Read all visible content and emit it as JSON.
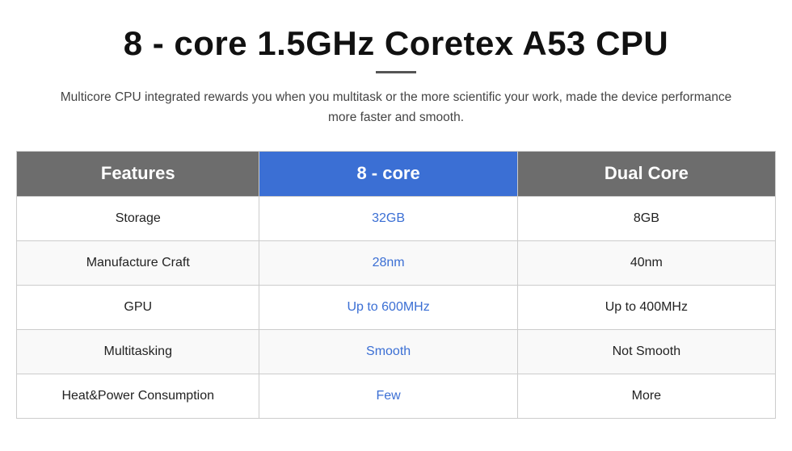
{
  "header": {
    "title": "8 - core 1.5GHz Coretex A53 CPU",
    "subtitle": "Multicore CPU integrated rewards you when you multitask or the more scientific your work, made the device performance more faster and smooth."
  },
  "table": {
    "columns": {
      "features": "Features",
      "col1": "8 - core",
      "col2": "Dual Core"
    },
    "rows": [
      {
        "feature": "Storage",
        "val1": "32GB",
        "val2": "8GB"
      },
      {
        "feature": "Manufacture Craft",
        "val1": "28nm",
        "val2": "40nm"
      },
      {
        "feature": "GPU",
        "val1": "Up to 600MHz",
        "val2": "Up to 400MHz"
      },
      {
        "feature": "Multitasking",
        "val1": "Smooth",
        "val2": "Not Smooth"
      },
      {
        "feature": "Heat&Power Consumption",
        "val1": "Few",
        "val2": "More"
      }
    ]
  },
  "colors": {
    "accent_blue": "#3b6fd4",
    "header_gray": "#6d6d6d",
    "text_dark": "#111111",
    "text_body": "#444444"
  }
}
